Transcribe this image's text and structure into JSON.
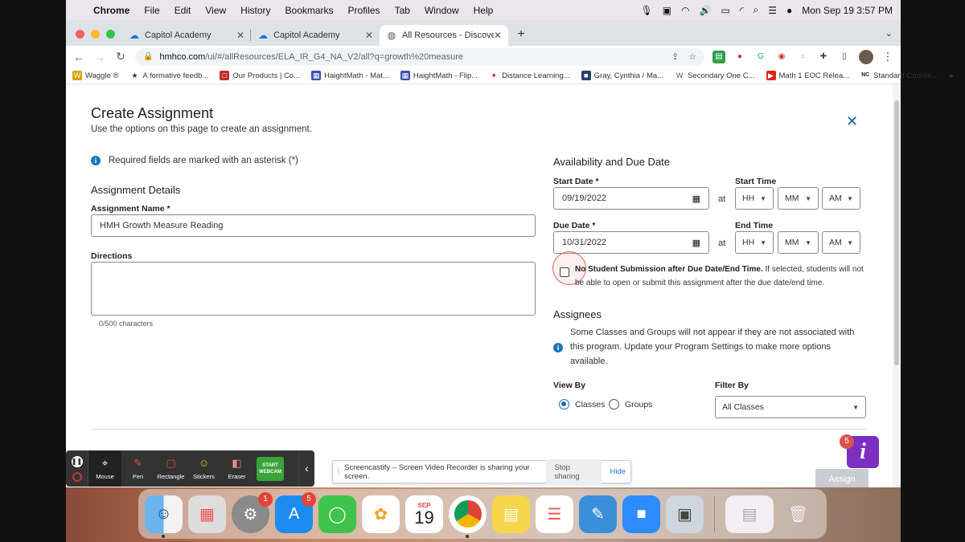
{
  "menubar": {
    "items": [
      "Chrome",
      "File",
      "Edit",
      "View",
      "History",
      "Bookmarks",
      "Profiles",
      "Tab",
      "Window",
      "Help"
    ],
    "datetime": "Mon Sep 19  3:57 PM"
  },
  "tabs": [
    {
      "label": "Capitol Academy"
    },
    {
      "label": "Capitol Academy"
    },
    {
      "label": "All Resources - Discover - HM"
    }
  ],
  "url": {
    "host": "hmhco.com",
    "path": "/ui/#/allResources/ELA_IR_G4_NA_V2/all?q=growth%20measure"
  },
  "bookmarks": [
    {
      "label": "Waggle ®",
      "color": "#d8a300"
    },
    {
      "label": "A formative feedb...",
      "color": "#555555"
    },
    {
      "label": "Our Products | Co...",
      "color": "#c0302a"
    },
    {
      "label": "HaightMath - Mat...",
      "color": "#3b4fb3"
    },
    {
      "label": "HaightMath - Flip...",
      "color": "#3b4fb3"
    },
    {
      "label": "Distance Learning...",
      "color": "#b02a2a"
    },
    {
      "label": "Gray, Cynthia / Ma...",
      "color": "#2d3e66"
    },
    {
      "label": "Secondary One C...",
      "color": "#555555"
    },
    {
      "label": "Math 1 EOC Relea...",
      "color": "#e62117"
    },
    {
      "label": "Standard Course...",
      "color": "#1a1a1a"
    }
  ],
  "page": {
    "title": "Create Assignment",
    "subtitle": "Use the options on this page to create an assignment.",
    "required_note": "Required fields are marked with an asterisk (*)",
    "assignment_details": {
      "heading": "Assignment Details",
      "name_label": "Assignment Name *",
      "name_value": "HMH Growth Measure Reading",
      "directions_label": "Directions",
      "char_count": "0/500 characters"
    },
    "availability": {
      "heading": "Availability and Due Date",
      "start_date_label": "Start Date *",
      "start_date_value": "09/19/2022",
      "start_time_label": "Start Time",
      "due_date_label": "Due Date *",
      "due_date_value": "10/31/2022",
      "end_time_label": "End Time",
      "at": "at",
      "hh": "HH",
      "mm": "MM",
      "ampm": "AM",
      "no_submission_bold": "No Student Submission after Due Date/End Time.",
      "no_submission_rest": " If selected, students will not be able to open or submit this assignment after the due date/end time."
    },
    "assignees": {
      "heading": "Assignees",
      "note": "Some Classes and Groups will not appear if they are not associated with this program. Update your Program Settings to make more options available.",
      "view_by_label": "View By",
      "view_by_options": [
        "Classes",
        "Groups"
      ],
      "view_by_selected": "Classes",
      "filter_by_label": "Filter By",
      "filter_by_value": "All Classes"
    },
    "assign_button": "Assign",
    "help_badge": "5",
    "help_glyph": "i"
  },
  "screencastify": {
    "tools": [
      "Mouse",
      "Pen",
      "Rectangle",
      "Stickers",
      "Eraser"
    ],
    "webcam_label": "START WEBCAM",
    "share_text": "Screencastify – Screen Video Recorder is sharing your screen.",
    "stop_sharing": "Stop sharing",
    "hide": "Hide"
  },
  "dock": {
    "calendar_month": "SEP",
    "calendar_day": "19",
    "badge_settings": "1",
    "badge_appstore": "5"
  }
}
